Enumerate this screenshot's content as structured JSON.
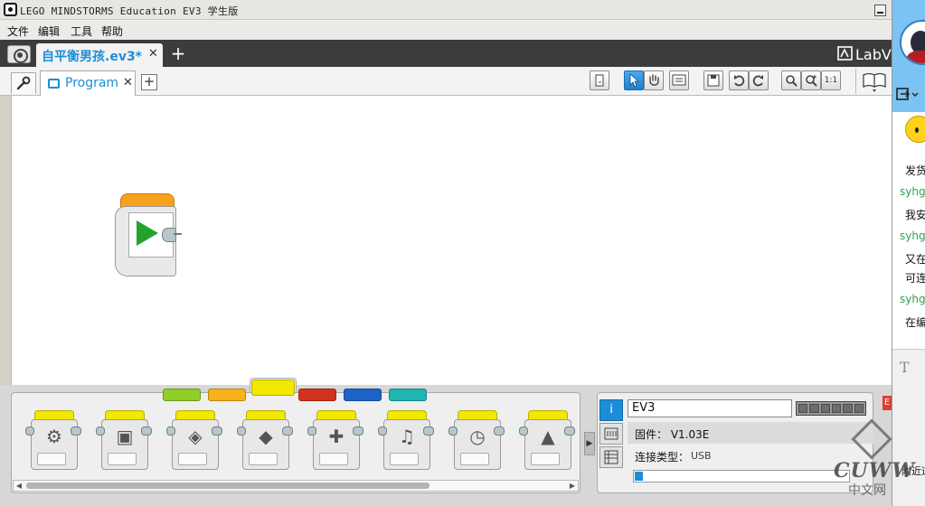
{
  "window": {
    "title": "LEGO MINDSTORMS Education EV3 学生版"
  },
  "menu": {
    "items": [
      "文件",
      "编辑",
      "工具",
      "帮助"
    ]
  },
  "project": {
    "tab_label": "自平衡男孩.ev3*",
    "close_glyph": "✕",
    "add_glyph": "+",
    "logo_text": "LabV"
  },
  "program": {
    "tab_label": "Program",
    "close_glyph": "✕",
    "add_glyph": "+"
  },
  "toolbar": {
    "zoom_reset_label": "1:1",
    "icons": [
      "comment-icon",
      "select-pointer-icon",
      "pan-hand-icon",
      "comment-block-icon",
      "save-icon",
      "undo-icon",
      "redo-icon",
      "zoom-out-icon",
      "zoom-in-icon",
      "zoom-reset-icon",
      "content-editor-icon"
    ]
  },
  "palette": {
    "tab_colors": [
      "#8fcf26",
      "#f7b21a",
      "#f2e800",
      "#d2321c",
      "#1c63c8",
      "#1fb5b0"
    ],
    "active_tab_color": "#f2e800",
    "blocks": [
      {
        "name": "medium-motor-block",
        "glyph": "⚙"
      },
      {
        "name": "large-motor-block",
        "glyph": "▣"
      },
      {
        "name": "move-steering-block",
        "glyph": "◈"
      },
      {
        "name": "move-tank-block",
        "glyph": "◆"
      },
      {
        "name": "display-block",
        "glyph": "✚"
      },
      {
        "name": "sound-block",
        "glyph": "♫"
      },
      {
        "name": "timer-wait-block",
        "glyph": "◷"
      },
      {
        "name": "brick-status-light-block",
        "glyph": "▲"
      }
    ]
  },
  "hardware": {
    "brick_name": "EV3",
    "firmware": "固件： V1.03E",
    "connection_label": "连接类型：",
    "connection_value": "USB",
    "battery_cells": 6,
    "memory_used_fraction": 0.04
  },
  "chat": {
    "lines": [
      {
        "type": "text",
        "text": "发货"
      },
      {
        "type": "name",
        "text": "syhg"
      },
      {
        "type": "text",
        "text": "我安"
      },
      {
        "type": "name",
        "text": "syhg"
      },
      {
        "type": "text",
        "text": "又在"
      },
      {
        "type": "text",
        "text": "可连"
      },
      {
        "type": "name",
        "text": "syhg"
      },
      {
        "type": "text",
        "text": "在编"
      }
    ],
    "font_glyph": "T",
    "bottom_text": "附近道"
  },
  "watermark": {
    "line1": "CUWW",
    "line2": "中文网"
  }
}
